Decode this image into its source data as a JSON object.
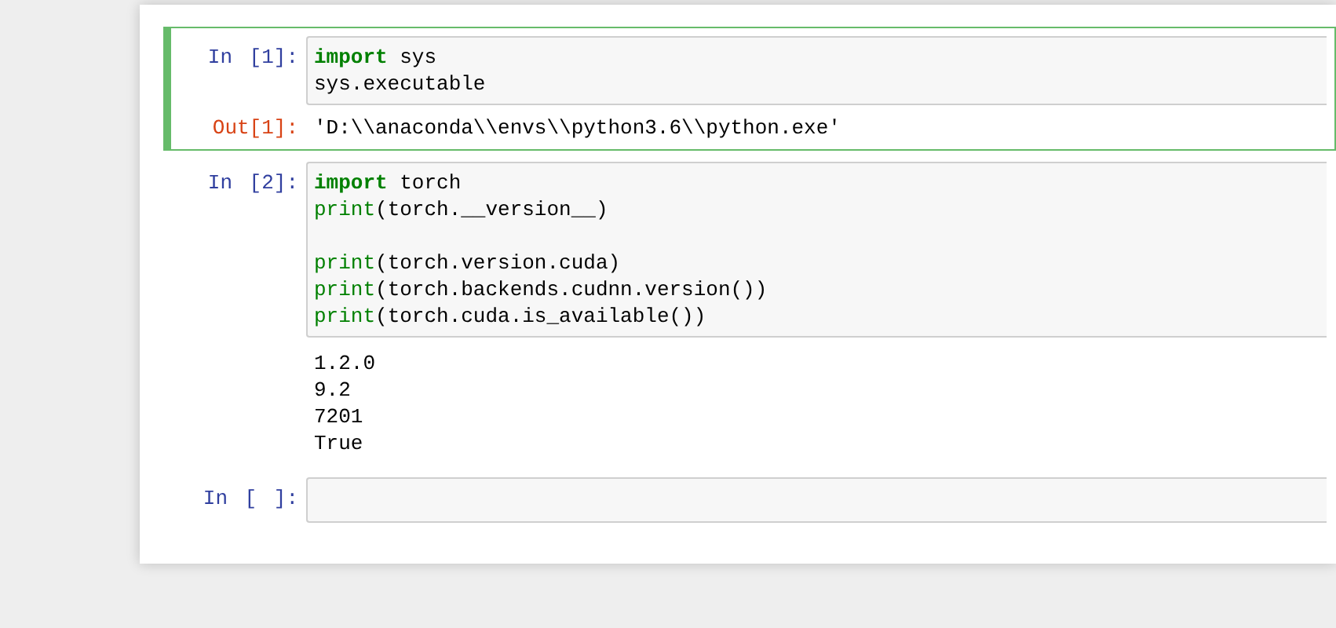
{
  "cells": [
    {
      "selected": true,
      "prompt": "In [1]:",
      "source": [
        {
          "kind": "keyword",
          "text": "import"
        },
        {
          "kind": "plain",
          "text": " sys\nsys.executable"
        }
      ],
      "output": {
        "prompt": "Out[1]:",
        "text": "'D:\\\\anaconda\\\\envs\\\\python3.6\\\\python.exe'"
      }
    },
    {
      "selected": false,
      "prompt": "In [2]:",
      "source": [
        {
          "kind": "keyword",
          "text": "import"
        },
        {
          "kind": "plain",
          "text": " torch\n"
        },
        {
          "kind": "builtin",
          "text": "print"
        },
        {
          "kind": "plain",
          "text": "(torch.__version__)\n\n"
        },
        {
          "kind": "builtin",
          "text": "print"
        },
        {
          "kind": "plain",
          "text": "(torch.version.cuda)\n"
        },
        {
          "kind": "builtin",
          "text": "print"
        },
        {
          "kind": "plain",
          "text": "(torch.backends.cudnn.version())\n"
        },
        {
          "kind": "builtin",
          "text": "print"
        },
        {
          "kind": "plain",
          "text": "(torch.cuda.is_available())"
        }
      ],
      "output": {
        "text": "1.2.0\n9.2\n7201\nTrue"
      }
    },
    {
      "selected": false,
      "prompt": "In [ ]:"
    }
  ]
}
